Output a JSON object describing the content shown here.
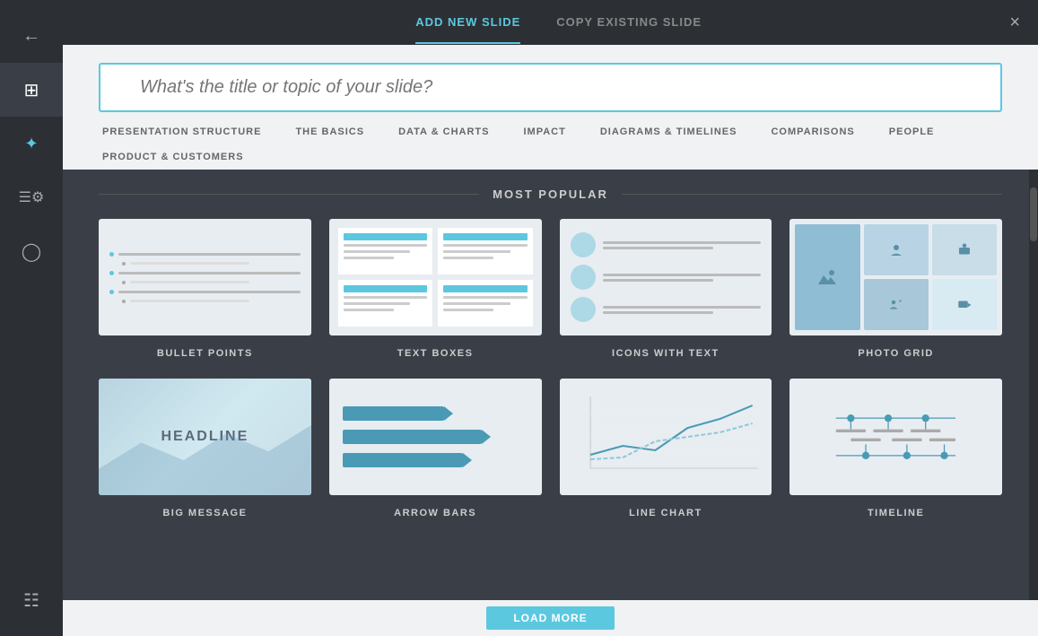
{
  "header": {
    "tab_add": "ADD NEW SLIDE",
    "tab_copy": "COPY EXISTING SLIDE",
    "close_label": "×"
  },
  "search": {
    "placeholder": "What's the title or topic of your slide?"
  },
  "nav_tabs": [
    "PRESENTATION STRUCTURE",
    "THE BASICS",
    "DATA & CHARTS",
    "IMPACT",
    "DIAGRAMS & TIMELINES",
    "COMPARISONS",
    "PEOPLE",
    "PRODUCT & CUSTOMERS"
  ],
  "section_title": "MOST POPULAR",
  "slides": [
    {
      "id": "bullet-points",
      "label": "BULLET POINTS"
    },
    {
      "id": "text-boxes",
      "label": "TEXT BOXES"
    },
    {
      "id": "icons-with-text",
      "label": "ICONS WITH TEXT"
    },
    {
      "id": "photo-grid",
      "label": "PHOTO GRID"
    },
    {
      "id": "big-message",
      "label": "BIG MESSAGE"
    },
    {
      "id": "arrow-bars",
      "label": "ARROW BARS"
    },
    {
      "id": "line-chart",
      "label": "LINE CHART"
    },
    {
      "id": "timeline",
      "label": "TIMELINE"
    }
  ],
  "sidebar": {
    "items": [
      {
        "icon": "←",
        "name": "back"
      },
      {
        "icon": "⊞",
        "name": "grid"
      },
      {
        "icon": "✦",
        "name": "dots"
      },
      {
        "icon": "☰⚙",
        "name": "settings"
      },
      {
        "icon": "⊙",
        "name": "camera"
      },
      {
        "icon": "☰",
        "name": "list"
      }
    ]
  },
  "load_more_label": "LOAD MORE"
}
